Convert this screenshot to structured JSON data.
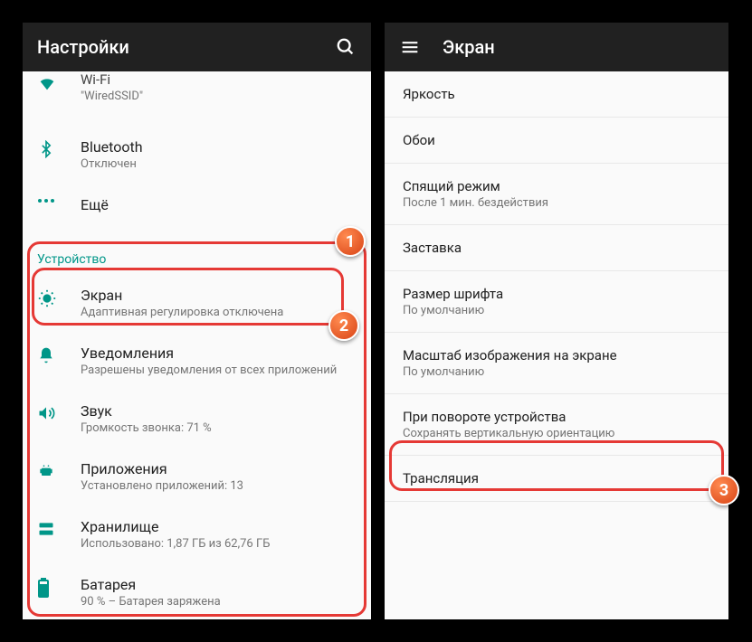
{
  "left": {
    "title": "Настройки",
    "wifi": {
      "title": "Wi-Fi",
      "sub": "\"WiredSSID\""
    },
    "bluetooth": {
      "title": "Bluetooth",
      "sub": "Отключен"
    },
    "more": {
      "title": "Ещё"
    },
    "section": "Устройство",
    "items": [
      {
        "title": "Экран",
        "sub": "Адаптивная регулировка отключена"
      },
      {
        "title": "Уведомления",
        "sub": "Разрешены уведомления от всех приложений"
      },
      {
        "title": "Звук",
        "sub": "Громкость звонка: 71 %"
      },
      {
        "title": "Приложения",
        "sub": "Установлено приложений: 13"
      },
      {
        "title": "Хранилище",
        "sub": "Использовано: 1,87 ГБ из 62,76 ГБ"
      },
      {
        "title": "Батарея",
        "sub": "90 % – Батарея заряжена"
      }
    ]
  },
  "right": {
    "title": "Экран",
    "items": [
      {
        "title": "Яркость",
        "sub": ""
      },
      {
        "title": "Обои",
        "sub": ""
      },
      {
        "title": "Спящий режим",
        "sub": "После 1 мин. бездействия"
      },
      {
        "title": "Заставка",
        "sub": ""
      },
      {
        "title": "Размер шрифта",
        "sub": "По умолчанию"
      },
      {
        "title": "Масштаб изображения на экране",
        "sub": "По умолчанию"
      },
      {
        "title": "При повороте устройства",
        "sub": "Сохранять вертикальную ориентацию"
      },
      {
        "title": "Трансляция",
        "sub": ""
      }
    ]
  },
  "badges": {
    "b1": "1",
    "b2": "2",
    "b3": "3"
  }
}
